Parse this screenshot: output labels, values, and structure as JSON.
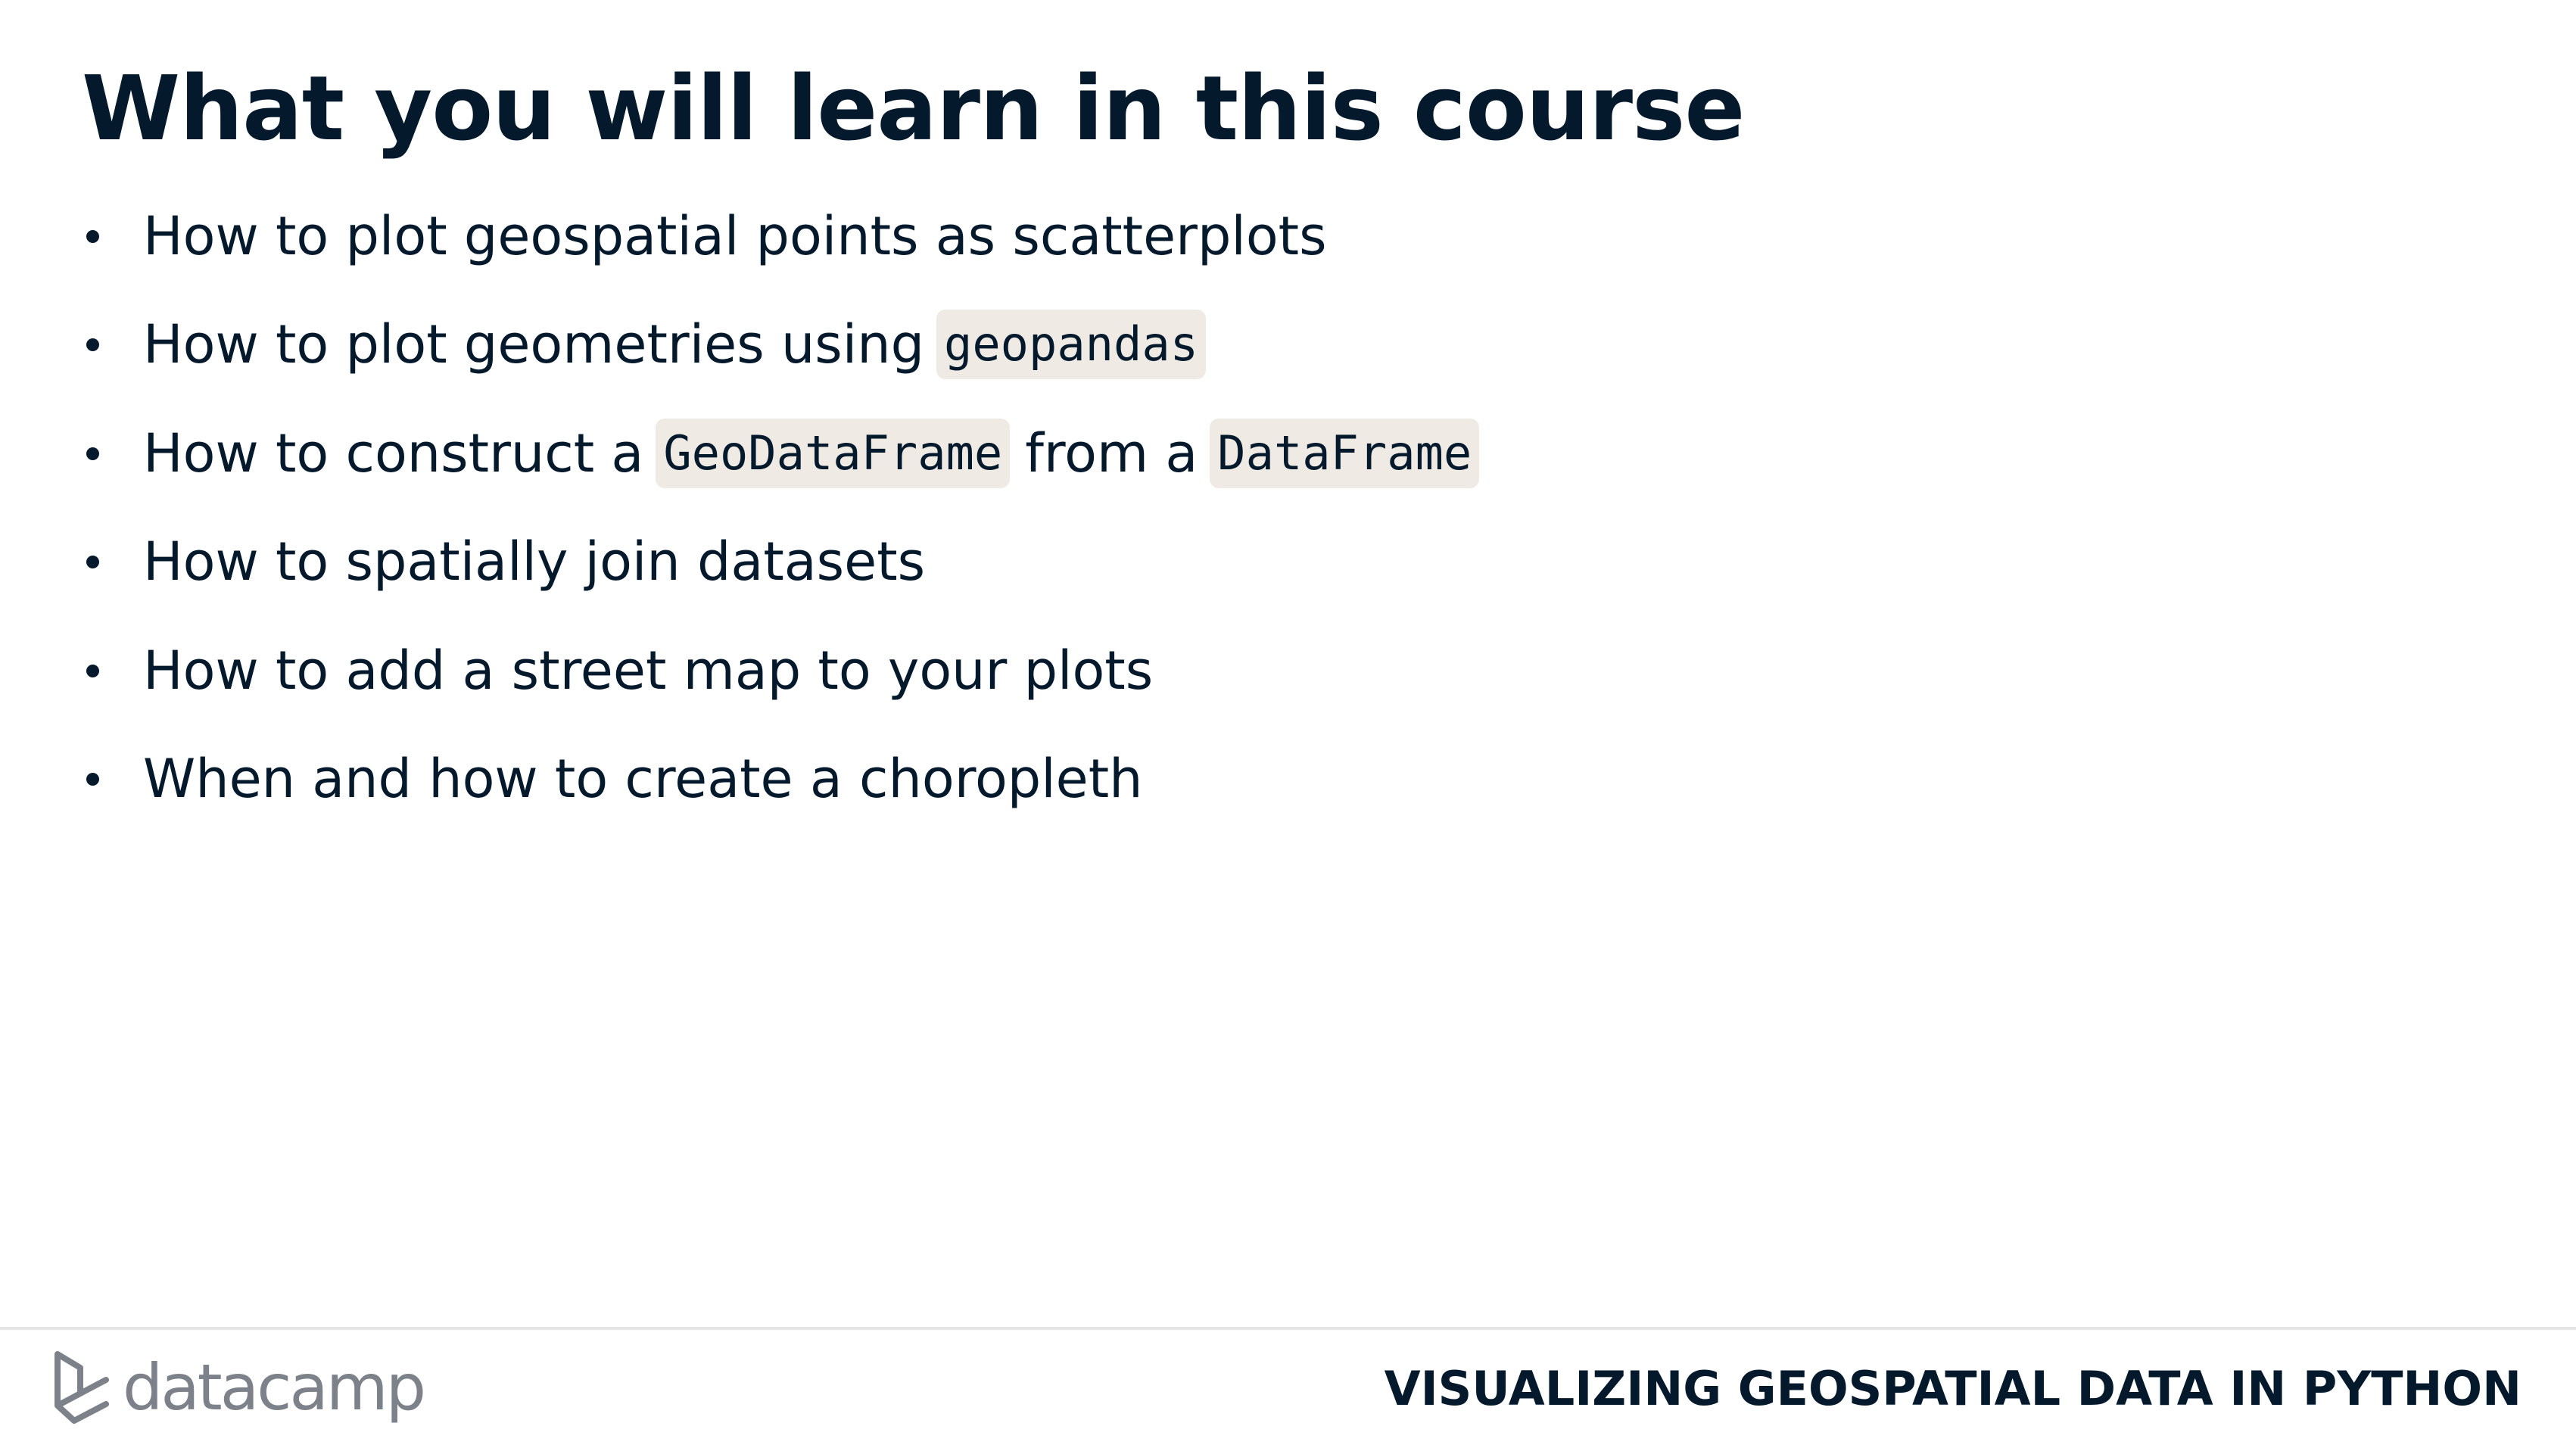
{
  "slide": {
    "title": "What you will learn in this course",
    "bullets": [
      {
        "segments": [
          {
            "type": "text",
            "text": "How to plot geospatial points as scatterplots"
          }
        ]
      },
      {
        "segments": [
          {
            "type": "text",
            "text": "How to plot geometries using"
          },
          {
            "type": "code",
            "text": "geopandas"
          }
        ]
      },
      {
        "segments": [
          {
            "type": "text",
            "text": "How to construct a"
          },
          {
            "type": "code",
            "text": "GeoDataFrame"
          },
          {
            "type": "text",
            "text": "from a"
          },
          {
            "type": "code",
            "text": "DataFrame"
          }
        ]
      },
      {
        "segments": [
          {
            "type": "text",
            "text": "How to spatially join datasets"
          }
        ]
      },
      {
        "segments": [
          {
            "type": "text",
            "text": "How to add a street map to your plots"
          }
        ]
      },
      {
        "segments": [
          {
            "type": "text",
            "text": "When and how to create a choropleth"
          }
        ]
      }
    ]
  },
  "footer": {
    "logo_text": "datacamp",
    "logo_icon": "datacamp-logo-icon",
    "course_name": "VISUALIZING GEOSPATIAL DATA IN PYTHON"
  },
  "colors": {
    "text": "#05192d",
    "code_background": "#efebe4",
    "logo_gray": "#7d8189",
    "divider": "#e5e5e5"
  }
}
